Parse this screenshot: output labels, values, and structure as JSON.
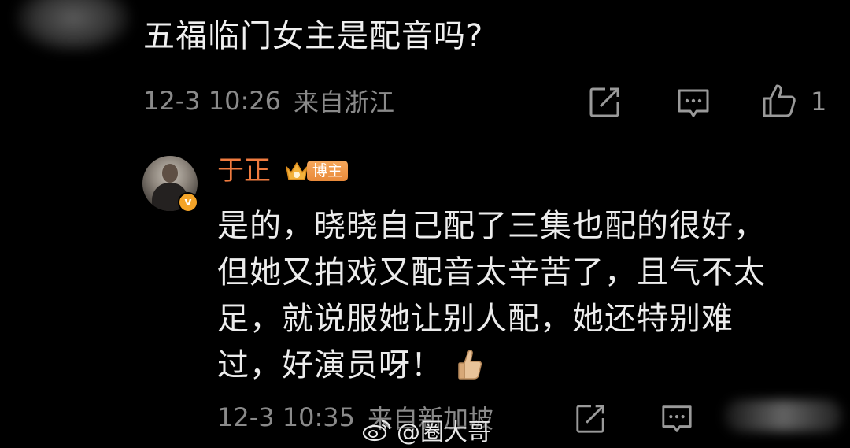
{
  "comment": {
    "question": "五福临门女主是配音吗?",
    "time": "12-3 10:26",
    "location": "来自浙江",
    "like_count": "1"
  },
  "reply": {
    "username": "于正",
    "badge": "博主",
    "verified_mark": "v",
    "lines": [
      "是的，晓晓自己配了三集也配的很好，",
      "但她又拍戏又配音太辛苦了，且气不太",
      "足，就说服她让别人配，她还特别难",
      "过，好演员呀！"
    ],
    "time": "12-3 10:35",
    "location": "来自新加坡",
    "emoji": "thumbs-up"
  },
  "watermark": {
    "text": "@圈大哥"
  },
  "colors": {
    "background": "#000000",
    "username": "#f07b3f",
    "badge": "#e98a3a",
    "meta": "#8a8a8a"
  }
}
